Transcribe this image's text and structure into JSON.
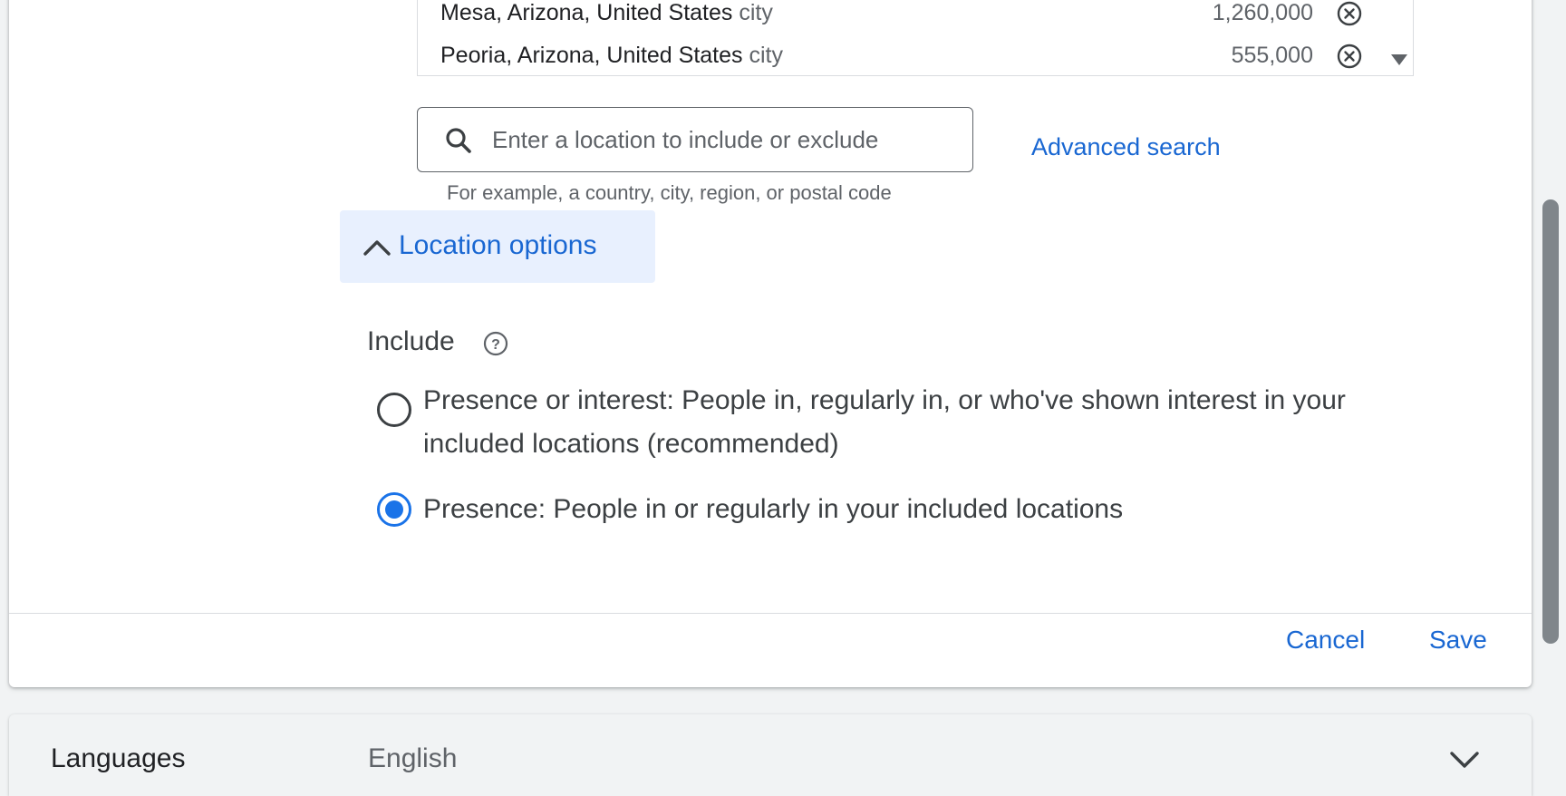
{
  "locations": [
    {
      "name": "Mesa, Arizona, United States",
      "type": "city",
      "reach": "1,260,000"
    },
    {
      "name": "Peoria, Arizona, United States",
      "type": "city",
      "reach": "555,000"
    }
  ],
  "search": {
    "placeholder": "Enter a location to include or exclude",
    "value": "",
    "helper": "For example, a country, city, region, or postal code"
  },
  "advanced_search_label": "Advanced search",
  "location_options": {
    "label": "Location options",
    "include_label": "Include",
    "options": [
      {
        "label": "Presence or interest: People in, regularly in, or who've shown interest in your included locations (recommended)",
        "selected": false
      },
      {
        "label": "Presence: People in or regularly in your included locations",
        "selected": true
      }
    ]
  },
  "footer": {
    "cancel_label": "Cancel",
    "save_label": "Save"
  },
  "languages": {
    "title": "Languages",
    "value": "English"
  },
  "colors": {
    "accent": "#1967d2",
    "radio_selected": "#1a73e8",
    "option_bg": "#e8f0fe"
  }
}
